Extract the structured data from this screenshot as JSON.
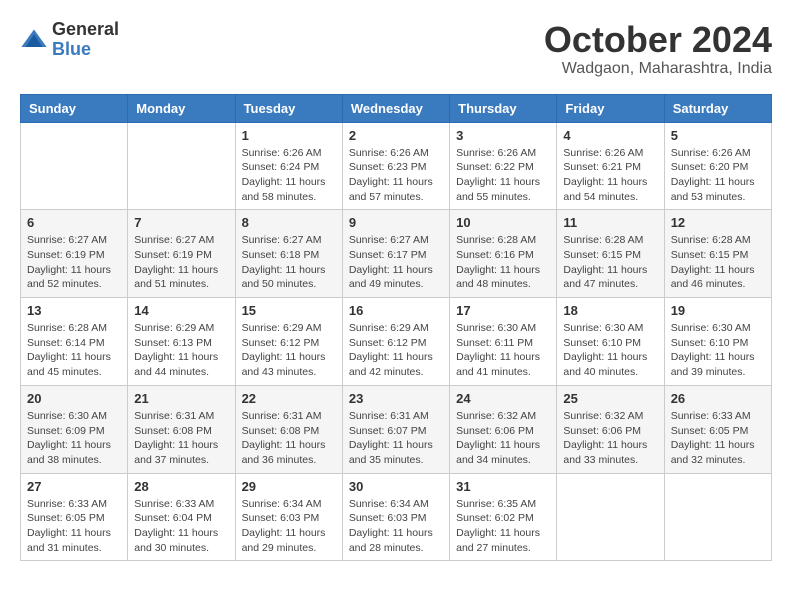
{
  "logo": {
    "general": "General",
    "blue": "Blue"
  },
  "title": "October 2024",
  "location": "Wadgaon, Maharashtra, India",
  "weekdays": [
    "Sunday",
    "Monday",
    "Tuesday",
    "Wednesday",
    "Thursday",
    "Friday",
    "Saturday"
  ],
  "weeks": [
    [
      {
        "day": "",
        "sunrise": "",
        "sunset": "",
        "daylight": ""
      },
      {
        "day": "",
        "sunrise": "",
        "sunset": "",
        "daylight": ""
      },
      {
        "day": "1",
        "sunrise": "Sunrise: 6:26 AM",
        "sunset": "Sunset: 6:24 PM",
        "daylight": "Daylight: 11 hours and 58 minutes."
      },
      {
        "day": "2",
        "sunrise": "Sunrise: 6:26 AM",
        "sunset": "Sunset: 6:23 PM",
        "daylight": "Daylight: 11 hours and 57 minutes."
      },
      {
        "day": "3",
        "sunrise": "Sunrise: 6:26 AM",
        "sunset": "Sunset: 6:22 PM",
        "daylight": "Daylight: 11 hours and 55 minutes."
      },
      {
        "day": "4",
        "sunrise": "Sunrise: 6:26 AM",
        "sunset": "Sunset: 6:21 PM",
        "daylight": "Daylight: 11 hours and 54 minutes."
      },
      {
        "day": "5",
        "sunrise": "Sunrise: 6:26 AM",
        "sunset": "Sunset: 6:20 PM",
        "daylight": "Daylight: 11 hours and 53 minutes."
      }
    ],
    [
      {
        "day": "6",
        "sunrise": "Sunrise: 6:27 AM",
        "sunset": "Sunset: 6:19 PM",
        "daylight": "Daylight: 11 hours and 52 minutes."
      },
      {
        "day": "7",
        "sunrise": "Sunrise: 6:27 AM",
        "sunset": "Sunset: 6:19 PM",
        "daylight": "Daylight: 11 hours and 51 minutes."
      },
      {
        "day": "8",
        "sunrise": "Sunrise: 6:27 AM",
        "sunset": "Sunset: 6:18 PM",
        "daylight": "Daylight: 11 hours and 50 minutes."
      },
      {
        "day": "9",
        "sunrise": "Sunrise: 6:27 AM",
        "sunset": "Sunset: 6:17 PM",
        "daylight": "Daylight: 11 hours and 49 minutes."
      },
      {
        "day": "10",
        "sunrise": "Sunrise: 6:28 AM",
        "sunset": "Sunset: 6:16 PM",
        "daylight": "Daylight: 11 hours and 48 minutes."
      },
      {
        "day": "11",
        "sunrise": "Sunrise: 6:28 AM",
        "sunset": "Sunset: 6:15 PM",
        "daylight": "Daylight: 11 hours and 47 minutes."
      },
      {
        "day": "12",
        "sunrise": "Sunrise: 6:28 AM",
        "sunset": "Sunset: 6:15 PM",
        "daylight": "Daylight: 11 hours and 46 minutes."
      }
    ],
    [
      {
        "day": "13",
        "sunrise": "Sunrise: 6:28 AM",
        "sunset": "Sunset: 6:14 PM",
        "daylight": "Daylight: 11 hours and 45 minutes."
      },
      {
        "day": "14",
        "sunrise": "Sunrise: 6:29 AM",
        "sunset": "Sunset: 6:13 PM",
        "daylight": "Daylight: 11 hours and 44 minutes."
      },
      {
        "day": "15",
        "sunrise": "Sunrise: 6:29 AM",
        "sunset": "Sunset: 6:12 PM",
        "daylight": "Daylight: 11 hours and 43 minutes."
      },
      {
        "day": "16",
        "sunrise": "Sunrise: 6:29 AM",
        "sunset": "Sunset: 6:12 PM",
        "daylight": "Daylight: 11 hours and 42 minutes."
      },
      {
        "day": "17",
        "sunrise": "Sunrise: 6:30 AM",
        "sunset": "Sunset: 6:11 PM",
        "daylight": "Daylight: 11 hours and 41 minutes."
      },
      {
        "day": "18",
        "sunrise": "Sunrise: 6:30 AM",
        "sunset": "Sunset: 6:10 PM",
        "daylight": "Daylight: 11 hours and 40 minutes."
      },
      {
        "day": "19",
        "sunrise": "Sunrise: 6:30 AM",
        "sunset": "Sunset: 6:10 PM",
        "daylight": "Daylight: 11 hours and 39 minutes."
      }
    ],
    [
      {
        "day": "20",
        "sunrise": "Sunrise: 6:30 AM",
        "sunset": "Sunset: 6:09 PM",
        "daylight": "Daylight: 11 hours and 38 minutes."
      },
      {
        "day": "21",
        "sunrise": "Sunrise: 6:31 AM",
        "sunset": "Sunset: 6:08 PM",
        "daylight": "Daylight: 11 hours and 37 minutes."
      },
      {
        "day": "22",
        "sunrise": "Sunrise: 6:31 AM",
        "sunset": "Sunset: 6:08 PM",
        "daylight": "Daylight: 11 hours and 36 minutes."
      },
      {
        "day": "23",
        "sunrise": "Sunrise: 6:31 AM",
        "sunset": "Sunset: 6:07 PM",
        "daylight": "Daylight: 11 hours and 35 minutes."
      },
      {
        "day": "24",
        "sunrise": "Sunrise: 6:32 AM",
        "sunset": "Sunset: 6:06 PM",
        "daylight": "Daylight: 11 hours and 34 minutes."
      },
      {
        "day": "25",
        "sunrise": "Sunrise: 6:32 AM",
        "sunset": "Sunset: 6:06 PM",
        "daylight": "Daylight: 11 hours and 33 minutes."
      },
      {
        "day": "26",
        "sunrise": "Sunrise: 6:33 AM",
        "sunset": "Sunset: 6:05 PM",
        "daylight": "Daylight: 11 hours and 32 minutes."
      }
    ],
    [
      {
        "day": "27",
        "sunrise": "Sunrise: 6:33 AM",
        "sunset": "Sunset: 6:05 PM",
        "daylight": "Daylight: 11 hours and 31 minutes."
      },
      {
        "day": "28",
        "sunrise": "Sunrise: 6:33 AM",
        "sunset": "Sunset: 6:04 PM",
        "daylight": "Daylight: 11 hours and 30 minutes."
      },
      {
        "day": "29",
        "sunrise": "Sunrise: 6:34 AM",
        "sunset": "Sunset: 6:03 PM",
        "daylight": "Daylight: 11 hours and 29 minutes."
      },
      {
        "day": "30",
        "sunrise": "Sunrise: 6:34 AM",
        "sunset": "Sunset: 6:03 PM",
        "daylight": "Daylight: 11 hours and 28 minutes."
      },
      {
        "day": "31",
        "sunrise": "Sunrise: 6:35 AM",
        "sunset": "Sunset: 6:02 PM",
        "daylight": "Daylight: 11 hours and 27 minutes."
      },
      {
        "day": "",
        "sunrise": "",
        "sunset": "",
        "daylight": ""
      },
      {
        "day": "",
        "sunrise": "",
        "sunset": "",
        "daylight": ""
      }
    ]
  ]
}
